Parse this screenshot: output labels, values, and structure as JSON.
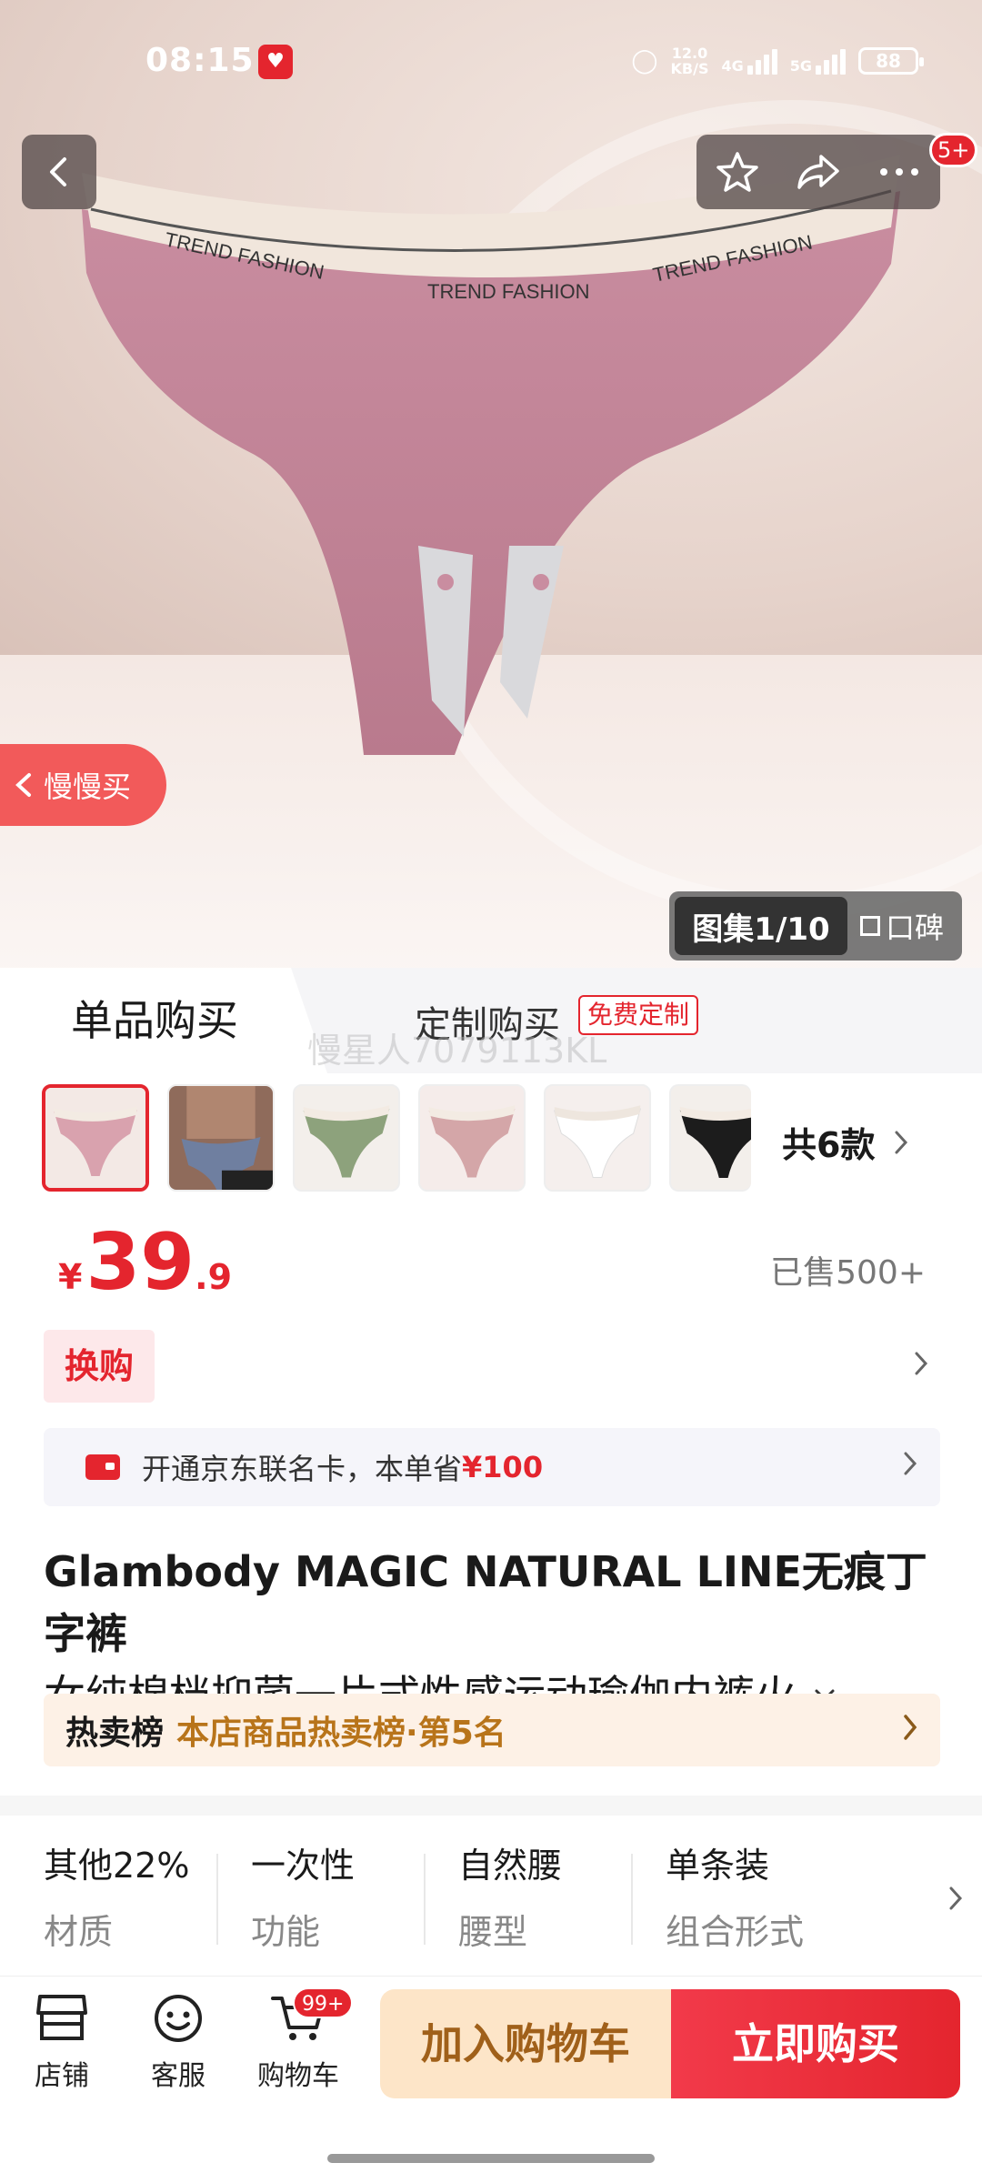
{
  "status_bar": {
    "time": "08:15",
    "network_speed": "12.0\nKB/S",
    "net_a": "4G",
    "net_b": "5G",
    "battery": "88"
  },
  "hero": {
    "print_left": "TREND FASHION",
    "print_mid": "TREND FASHION",
    "print_right": "TREND FASHION",
    "cart_count": "5+",
    "slow_buy_label": "慢慢买",
    "gallery_label": "图集1/10",
    "reviews_label": "口碑"
  },
  "tabs": {
    "single": "单品购买",
    "custom": "定制购买",
    "free_custom": "免费定制",
    "watermark": "慢星人7079113KL"
  },
  "variants": {
    "total_label": "共6款",
    "colors": [
      "#d9a2ae",
      "#4a4a4a",
      "#8da27c",
      "#d4a6a8",
      "#f2f0ee",
      "#1c1c1c"
    ]
  },
  "price": {
    "currency": "¥",
    "integer": "39",
    "decimal": ".9",
    "sold": "已售500+"
  },
  "swap_label": "换购",
  "card_offer": {
    "text": "开通京东联名卡，本单省",
    "amount": "¥100"
  },
  "product_title": {
    "line1": "Glambody MAGIC NATURAL LINE无痕丁字裤",
    "line2": "女纯棉档抑菌一片式性感运动瑜伽内裤火"
  },
  "hot_rank": {
    "label": "热卖榜",
    "text": "本店商品热卖榜·第5名"
  },
  "attributes": [
    {
      "value": "其他22%",
      "key": "材质"
    },
    {
      "value": "一次性",
      "key": "功能"
    },
    {
      "value": "自然腰",
      "key": "腰型"
    },
    {
      "value": "单条装",
      "key": "组合形式"
    }
  ],
  "bottom_bar": {
    "store": "店铺",
    "service": "客服",
    "cart": "购物车",
    "cart_badge": "99+",
    "add_to_cart": "加入购物车",
    "buy_now": "立即购买"
  },
  "colors": {
    "accent_red": "#e4252e",
    "cart_button_bg": "#fde5c8"
  }
}
